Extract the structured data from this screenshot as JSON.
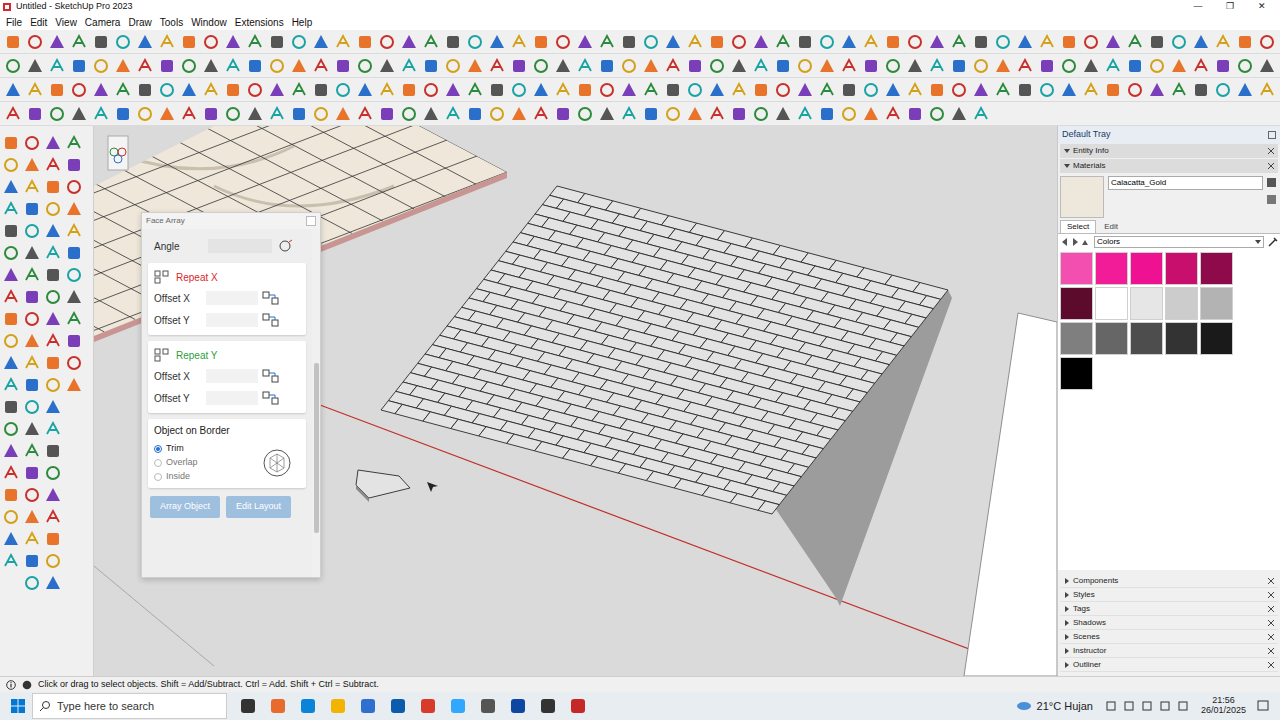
{
  "window": {
    "title": "Untitled - SketchUp Pro 2023",
    "controls": [
      "—",
      "❐",
      "✕"
    ]
  },
  "menu": [
    "File",
    "Edit",
    "View",
    "Camera",
    "Draw",
    "Tools",
    "Window",
    "Extensions",
    "Help"
  ],
  "face_array": {
    "title": "Face Array",
    "angle": {
      "label": "Angle",
      "value": ""
    },
    "repeat_x": {
      "label": "Repeat X",
      "color": "#d9262c",
      "fields": [
        {
          "label": "Offset X",
          "value": ""
        },
        {
          "label": "Offset Y",
          "value": ""
        }
      ]
    },
    "repeat_y": {
      "label": "Repeat Y",
      "color": "#2e9e3c",
      "fields": [
        {
          "label": "Offset X",
          "value": ""
        },
        {
          "label": "Offset Y",
          "value": ""
        }
      ]
    },
    "border": {
      "title": "Object on Border",
      "options": [
        {
          "label": "Trim",
          "selected": true
        },
        {
          "label": "Overlap",
          "selected": false
        },
        {
          "label": "Inside",
          "selected": false
        }
      ]
    },
    "buttons": [
      "Array Object",
      "Edit Layout"
    ]
  },
  "tray": {
    "title": "Default Tray",
    "open_sections": [
      "Entity Info",
      "Materials"
    ],
    "material_name": "Calacatta_Gold",
    "tabs": [
      {
        "label": "Select",
        "selected": true
      },
      {
        "label": "Edit",
        "selected": false
      }
    ],
    "library": "Colors",
    "swatches": [
      {
        "color": "#f24fb0"
      },
      {
        "color": "#f21c98"
      },
      {
        "color": "#ee1191"
      },
      {
        "color": "#c80f6e"
      },
      {
        "color": "#8f0a4a"
      },
      {
        "color": "#5c0b2c"
      },
      {
        "color": "#ffffff"
      },
      {
        "color": "#e6e6e6"
      },
      {
        "color": "#cccccc"
      },
      {
        "color": "#b3b3b3"
      },
      {
        "color": "#7f7f7f"
      },
      {
        "color": "#666666"
      },
      {
        "color": "#4d4d4d"
      },
      {
        "color": "#333333"
      },
      {
        "color": "#1a1a1a"
      },
      {
        "color": "#000000"
      }
    ],
    "collapsed_sections": [
      "Components",
      "Styles",
      "Tags",
      "Shadows",
      "Scenes",
      "Instructor",
      "Outliner"
    ]
  },
  "status_bar": "Click or drag to select objects. Shift = Add/Subtract. Ctrl = Add. Shift + Ctrl = Subtract.",
  "taskbar": {
    "search_placeholder": "Type here to search",
    "weather": "21°C Hujan",
    "time": "21:56",
    "date": "26/01/2025"
  }
}
